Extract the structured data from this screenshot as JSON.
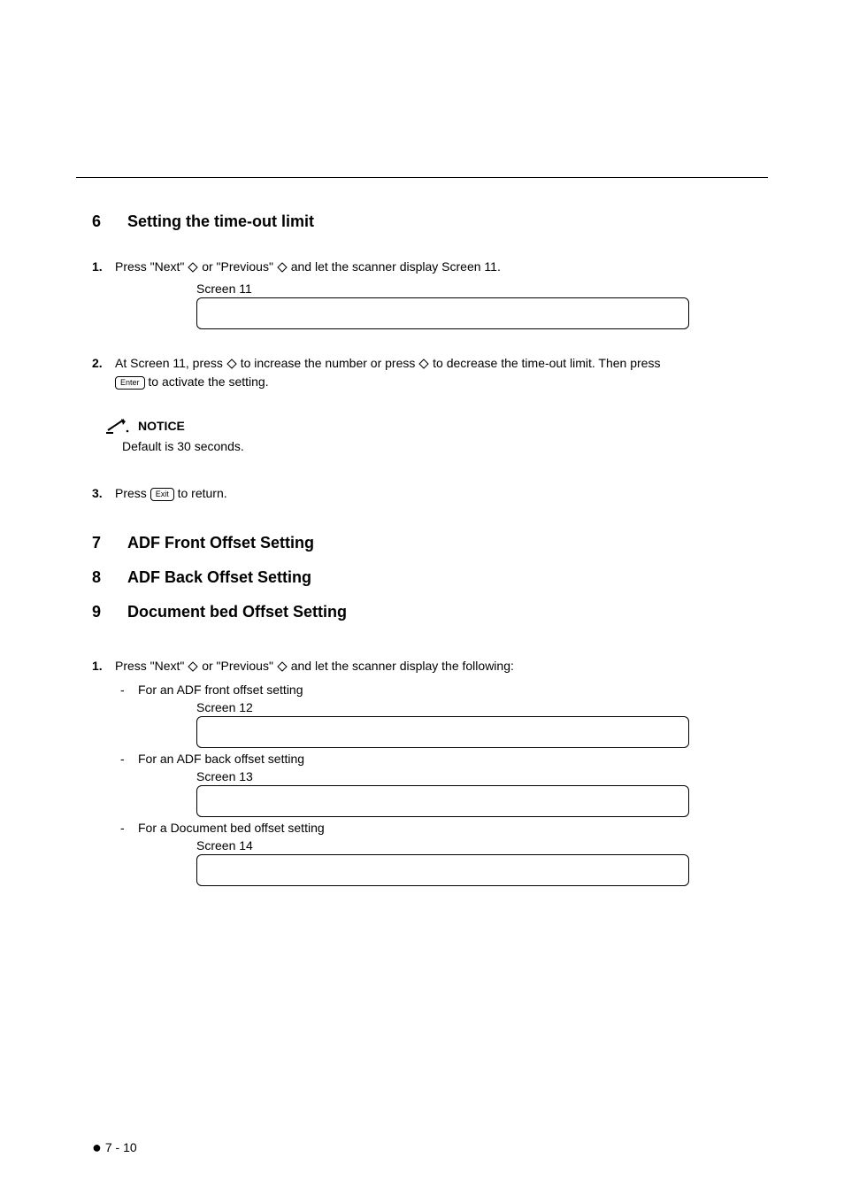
{
  "section6": {
    "num": "6",
    "title": "Setting the time-out limit",
    "step1": {
      "num": "1.",
      "pre": "Press \"Next\" ",
      "mid": " or \"Previous\" ",
      "post": " and let the scanner display Screen 11."
    },
    "screen11_label": "Screen 11",
    "step2": {
      "num": "2.",
      "pre": "At Screen 11, press ",
      "mid": " to increase the number or press ",
      "post": " to decrease the time-out limit. Then press ",
      "enter_key": "Enter",
      "tail": " to activate the setting."
    },
    "notice_label": "NOTICE",
    "notice_body": "Default is 30 seconds.",
    "step3": {
      "num": "3.",
      "pre": "Press ",
      "exit_key": "Exit",
      "post": " to return."
    }
  },
  "section7": {
    "num": "7",
    "title": "ADF Front Offset Setting"
  },
  "section8": {
    "num": "8",
    "title": "ADF Back Offset Setting"
  },
  "section9": {
    "num": "9",
    "title": "Document bed Offset Setting",
    "step1": {
      "num": "1.",
      "pre": "Press \"Next\" ",
      "mid": " or \"Previous\" ",
      "post": " and let the scanner display the following:"
    },
    "sub1": "For an ADF front offset setting",
    "screen12_label": "Screen 12",
    "sub2": "For an ADF back offset setting",
    "screen13_label": "Screen 13",
    "sub3": "For a Document bed offset setting",
    "screen14_label": "Screen 14"
  },
  "footer": "7 - 10"
}
